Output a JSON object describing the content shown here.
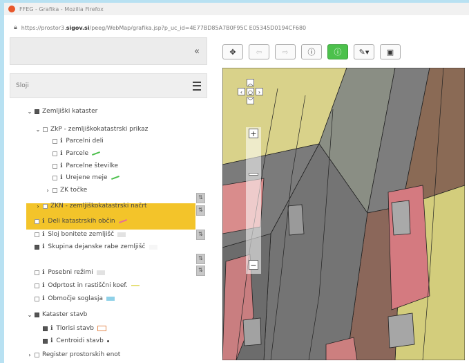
{
  "window": {
    "title": "FFEG - Grafika - Mozilla Firefox"
  },
  "browser": {
    "url_prefix": "https://prostor3.",
    "url_domain": "sigov.si",
    "url_rest": "/peeg/WebMap/grafika.jsp?p_uc_id=4E77BD85A7B0F95C E05345D0194CF680"
  },
  "sidebar": {
    "collapse_label": "«",
    "layers_title": "Sloji"
  },
  "tree": [
    {
      "label": "Zemljiški kataster",
      "chev": "⌄",
      "checked": true,
      "info": false,
      "level": 0
    },
    {
      "label": "ZkP - zemljiškokatastrski prikaz",
      "chev": "⌄",
      "checked": false,
      "info": false,
      "level": 1
    },
    {
      "label": "Parcelni deli",
      "chev": "",
      "checked": false,
      "info": true,
      "level": 2
    },
    {
      "label": "Parcele",
      "chev": "",
      "checked": false,
      "info": true,
      "level": 2,
      "swatch": "green-line"
    },
    {
      "label": "Parcelne številke",
      "chev": "",
      "checked": false,
      "info": true,
      "level": 2
    },
    {
      "label": "Urejene meje",
      "chev": "",
      "checked": false,
      "info": true,
      "level": 2,
      "swatch": "green-line"
    },
    {
      "label": "ZK točke",
      "chev": "›",
      "checked": false,
      "info": false,
      "level": 2
    },
    {
      "label": "ZKN - zemljiškokatastrski načrt",
      "chev": "›",
      "checked": false,
      "info": false,
      "level": 1
    },
    {
      "label": "Deli katastrskih občin",
      "chev": "",
      "checked": false,
      "info": true,
      "level": 0,
      "swatch": "pink-line"
    },
    {
      "label": "Sloj bonitete zemljišč",
      "chev": "",
      "checked": false,
      "info": true,
      "level": 0,
      "swatch": "grey-box"
    },
    {
      "label": "Skupina dejanske rabe zemljišč",
      "chev": "",
      "checked": true,
      "info": true,
      "level": 0,
      "swatch": "white-box",
      "selected": true
    },
    {
      "label": "Posebni režimi",
      "chev": "",
      "checked": false,
      "info": true,
      "level": 0,
      "swatch": "grey-box"
    },
    {
      "label": "Odprtost in rastiščni koef.",
      "chev": "",
      "checked": false,
      "info": true,
      "level": 0,
      "swatch": "yellow-line"
    },
    {
      "label": "Območje soglasja",
      "chev": "",
      "checked": false,
      "info": true,
      "level": 0,
      "swatch": "blue-box"
    },
    {
      "label": "Kataster stavb",
      "chev": "⌄",
      "checked": true,
      "info": false,
      "level": 0
    },
    {
      "label": "Tlorisi stavb",
      "chev": "",
      "checked": true,
      "info": true,
      "level": 1,
      "swatch": "orange-box"
    },
    {
      "label": "Centroidi stavb",
      "chev": "",
      "checked": true,
      "info": true,
      "level": 1,
      "swatch": "dot"
    },
    {
      "label": "Register prostorskih enot",
      "chev": "›",
      "checked": false,
      "info": false,
      "level": 0
    }
  ],
  "toolbar": [
    {
      "name": "pan-button",
      "icon": "✥",
      "state": "normal"
    },
    {
      "name": "back-button",
      "icon": "⇦",
      "state": "disabled"
    },
    {
      "name": "forward-button",
      "icon": "⇨",
      "state": "disabled"
    },
    {
      "name": "info-button",
      "icon": "ⓘ",
      "state": "normal"
    },
    {
      "name": "info-active-button",
      "icon": "ⓘ",
      "state": "active"
    },
    {
      "name": "edit-dropdown-button",
      "icon": "✎▾",
      "state": "normal"
    },
    {
      "name": "screenshot-button",
      "icon": "▣",
      "state": "normal"
    }
  ],
  "map": {
    "zoom_in": "+",
    "zoom_out": "−",
    "zoom_level": 0.72
  }
}
